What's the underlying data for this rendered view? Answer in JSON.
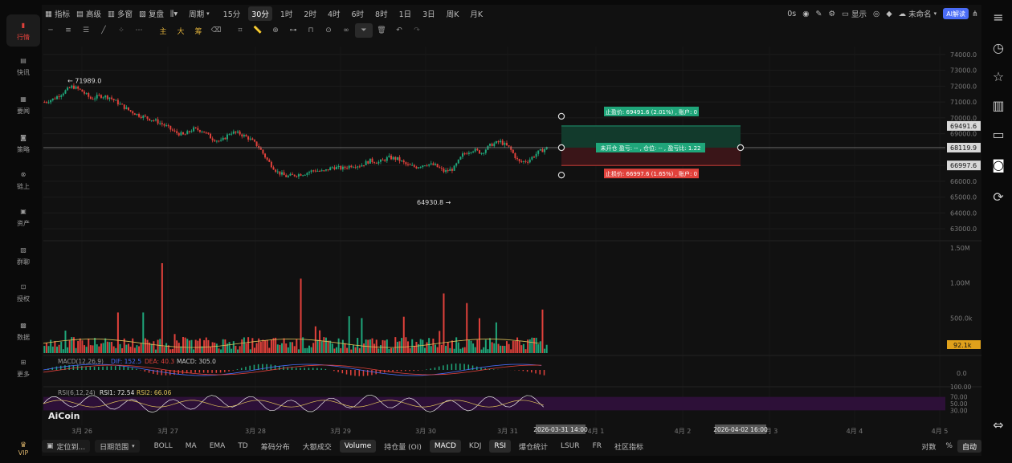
{
  "nav": [
    {
      "label": "行情",
      "icon": "bar-chart-icon",
      "active": true
    },
    {
      "label": "快讯",
      "icon": "news-icon"
    },
    {
      "label": "要闻",
      "icon": "document-icon"
    },
    {
      "label": "策略",
      "icon": "robot-icon"
    },
    {
      "label": "链上",
      "icon": "chain-icon"
    },
    {
      "label": "资产",
      "icon": "wallet-icon"
    },
    {
      "label": "群聊",
      "icon": "chat-icon"
    },
    {
      "label": "授权",
      "icon": "key-icon"
    },
    {
      "label": "数据",
      "icon": "data-icon"
    },
    {
      "label": "更多",
      "icon": "grid-icon"
    }
  ],
  "vip_label": "VIP",
  "topbar": {
    "indicators": "指标",
    "advanced": "高级",
    "multi": "多窗",
    "replay": "复盘",
    "period": "周期",
    "intervals": [
      "15分",
      "30分",
      "1时",
      "2时",
      "4时",
      "6时",
      "8时",
      "1日",
      "3日",
      "周K",
      "月K"
    ],
    "selected_interval": "30分",
    "countdown": "0s",
    "display": "显示",
    "unnamed": "未命名",
    "ai": "AI解读"
  },
  "toolbar2": {
    "main": "主",
    "big": "大",
    "chips": "筹"
  },
  "chart_data": {
    "type": "candlestick",
    "x_ticks": [
      "3月 26",
      "3月 27",
      "3月 28",
      "3月 29",
      "3月 30",
      "3月 31",
      "4月 1",
      "4月 2",
      "4月 3",
      "4月 4",
      "4月 5"
    ],
    "y_ticks": [
      "74000.0",
      "73000.0",
      "72000.0",
      "71000.0",
      "70000.0",
      "69000.0",
      "68000.0",
      "67000.0",
      "66000.0",
      "65000.0",
      "64000.0",
      "63000.0"
    ],
    "price_ylim": [
      62500,
      74500
    ],
    "close_path": [
      71000,
      71200,
      71600,
      71989,
      71700,
      71200,
      71400,
      71300,
      70900,
      70500,
      70200,
      70000,
      69800,
      69500,
      69100,
      68900,
      69300,
      69200,
      68700,
      68500,
      69100,
      69000,
      68700,
      68200,
      67300,
      66600,
      66300,
      66400,
      66500,
      66700,
      66600,
      66900,
      66800,
      67000,
      67000,
      67300,
      67200,
      67500,
      67400,
      67000,
      66900,
      67100,
      67000,
      66600,
      66800,
      67700,
      68000,
      67800,
      68300,
      68500,
      68100,
      67200,
      67300,
      67800,
      68100
    ],
    "high_label": "71989.0",
    "low_label": "64930.8",
    "last_price": "68119.9",
    "stop_profit_price": "69491.6",
    "stop_loss_price": "66997.6",
    "trade_box": {
      "take_profit_label": "止盈价: 69491.6 (2.01%) , 账户: 0",
      "entry_label": "未开仓 盈亏: -- , 仓位: -- , 盈亏比: 1.22",
      "stop_loss_label": "止损价: 66997.6 (1.65%) , 账户: 0"
    },
    "volume_ticks": [
      "1.50M",
      "1.00M",
      "500.0k"
    ],
    "volume_last": "92.1k",
    "macd_label": "MACD(12,26,9)",
    "macd_dif": "DIF: 152.5",
    "macd_dea": "DEA: 40.3",
    "macd_val": "MACD: 305.0",
    "macd_tick": "0.0",
    "rsi_label": "RSI(6,12,24)",
    "rsi1": "RSI1: 72.54",
    "rsi2": "RSI2: 66.06",
    "rsi_ticks": [
      "100.00",
      "70.00",
      "50.00",
      "30.00"
    ],
    "cursor_time_left": "2026-03-31 14:00",
    "cursor_time_right": "2026-04-02 16:00",
    "watermark": "AiCoin"
  },
  "bottombar": {
    "locate": "定位到...",
    "date_range": "日期范围",
    "items": [
      "BOLL",
      "MA",
      "EMA",
      "TD",
      "筹码分布",
      "大额成交",
      "Volume",
      "持仓量 (OI)",
      "MACD",
      "KDJ",
      "RSI",
      "爆仓统计",
      "LSUR",
      "FR",
      "社区指标"
    ],
    "selected": [
      "Volume",
      "MACD",
      "RSI"
    ],
    "log": "对数",
    "pct": "%",
    "auto": "自动"
  },
  "colors": {
    "up": "#1fa67a",
    "down": "#e0413b",
    "bg": "#111111",
    "accent": "#e0413b",
    "ai": "#4a6cf7"
  }
}
